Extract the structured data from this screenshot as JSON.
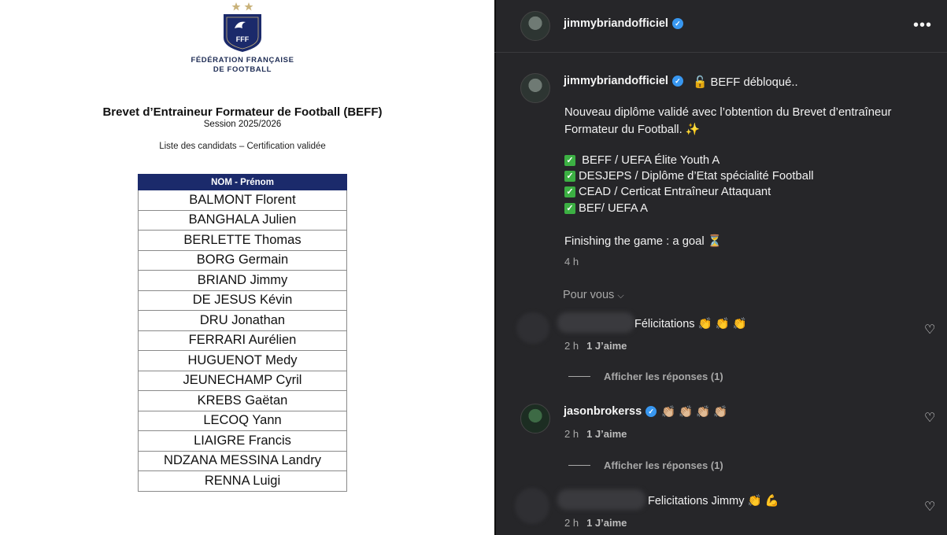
{
  "document": {
    "federation_line1": "FÉDÉRATION FRANÇAISE",
    "federation_line2": "DE FOOTBALL",
    "logo_text": "FFF",
    "title": "Brevet d’Entraineur Formateur de Football (BEFF)",
    "session": "Session 2025/2026",
    "subtitle": "Liste des candidats – Certification validée",
    "table_header": "NOM - Prénom",
    "candidates": [
      "BALMONT Florent",
      "BANGHALA Julien",
      "BERLETTE Thomas",
      "BORG Germain",
      "BRIAND Jimmy",
      "DE JESUS Kévin",
      "DRU Jonathan",
      "FERRARI Aurélien",
      "HUGUENOT Medy",
      "JEUNECHAMP Cyril",
      "KREBS Gaëtan",
      "LECOQ Yann",
      "LIAIGRE Francis",
      "NDZANA MESSINA Landry",
      "RENNA Luigi"
    ]
  },
  "instagram": {
    "header": {
      "username": "jimmybriandofficiel",
      "more": "•••"
    },
    "caption": {
      "username": "jimmybriandofficiel",
      "first": "🔓 BEFF débloqué..",
      "line1": "Nouveau diplôme validé avec l’obtention du Brevet d’entraîneur",
      "line2": "Formateur du Football. ✨",
      "items": [
        " BEFF / UEFA Élite Youth A",
        "DESJEPS / Diplôme d’Etat spécialité Football",
        "CEAD / Certicat Entraîneur Attaquant",
        "BEF/ UEFA A"
      ],
      "final": "Finishing the game : a goal ⏳",
      "time": "4 h"
    },
    "pour_vous": "Pour vous",
    "comments": [
      {
        "username": "",
        "text": "Félicitations 👏 👏 👏",
        "time": "2 h",
        "likes": "1 J’aime",
        "replies": "Afficher les réponses (1)"
      },
      {
        "username": "jasonbrokerss",
        "text": "👏🏼 👏🏼 👏🏼 👏🏼",
        "time": "2 h",
        "likes": "1 J’aime",
        "replies": "Afficher les réponses (1)"
      },
      {
        "username": "",
        "text": "Felicitations Jimmy 👏 💪",
        "time": "2 h",
        "likes": "1 J’aime"
      }
    ],
    "colors": {
      "background": "#262629",
      "verified": "#3897f0",
      "muted": "#a8a8a8"
    }
  }
}
